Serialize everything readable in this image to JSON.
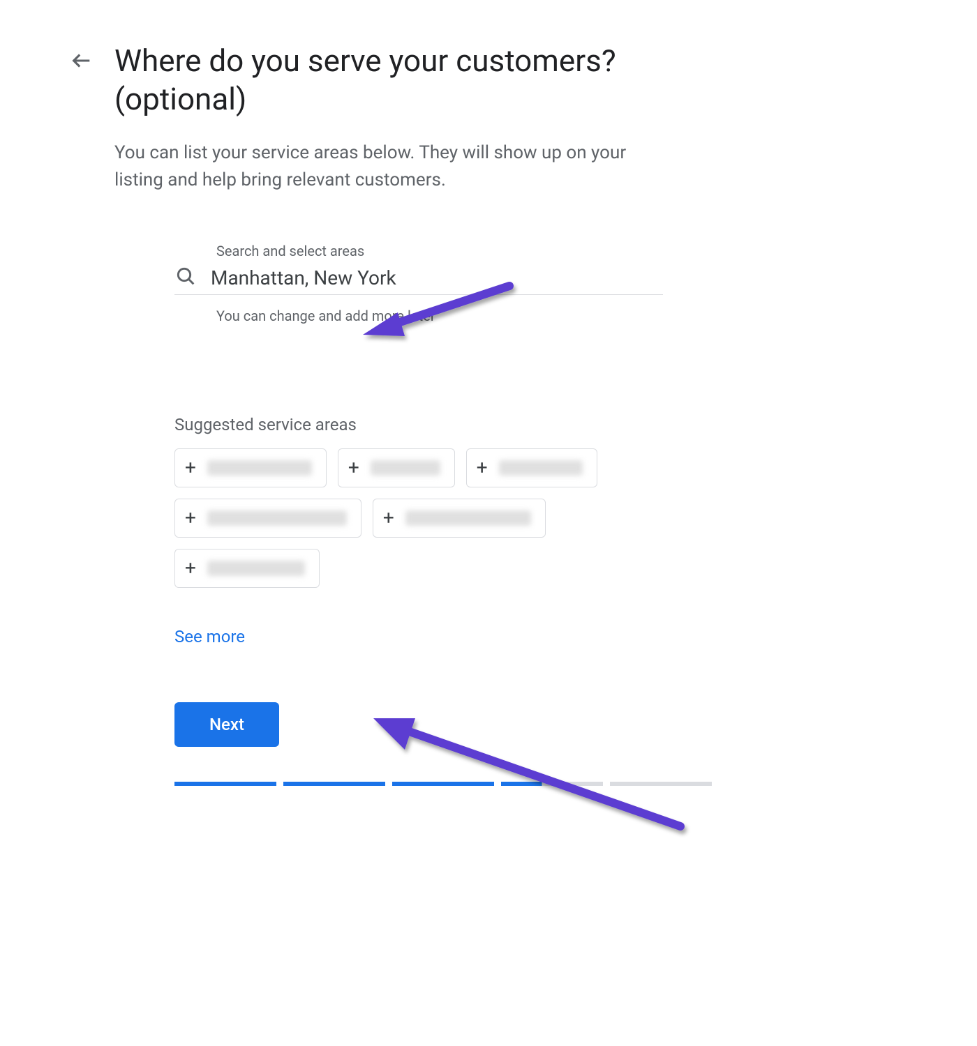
{
  "header": {
    "title": "Where do you serve your customers? (optional)",
    "subtitle": "You can list your service areas below. They will show up on your listing and help bring relevant customers."
  },
  "search": {
    "label": "Search and select areas",
    "value": "Manhattan, New York",
    "hint": "You can change and add more later"
  },
  "suggestions": {
    "title": "Suggested service areas",
    "see_more": "See more"
  },
  "actions": {
    "next": "Next"
  },
  "icons": {
    "back": "back-arrow-icon",
    "search": "search-icon",
    "plus": "plus-icon"
  },
  "annotations": {
    "arrow_color": "#5b3dd1"
  },
  "progress": {
    "segments": [
      "full",
      "full",
      "full",
      "partial",
      "empty"
    ]
  }
}
